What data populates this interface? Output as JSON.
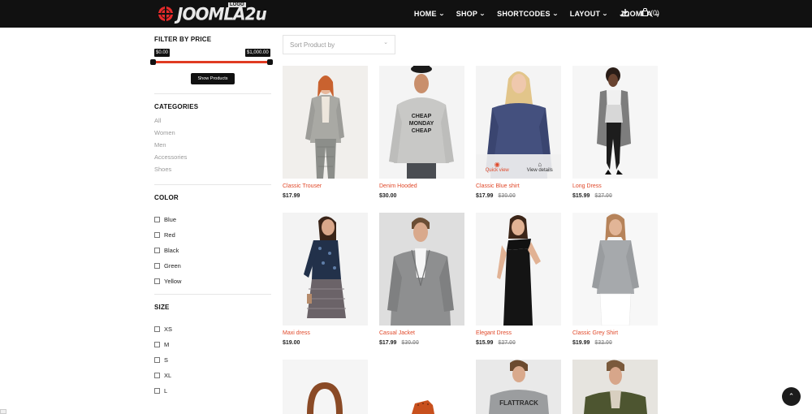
{
  "header": {
    "logo_text": "JOOMLA2u",
    "logo_badge": "LOGO",
    "nav": [
      {
        "label": "HOME"
      },
      {
        "label": "SHOP"
      },
      {
        "label": "SHORTCODES"
      },
      {
        "label": "LAYOUT"
      },
      {
        "label": "JOOMLA"
      }
    ],
    "cart_label": "(0)"
  },
  "sidebar": {
    "price": {
      "title": "FILTER BY PRICE",
      "min": "$0.00",
      "max": "$1,000.00",
      "button": "Show Products",
      "slider_color": "#e03b22"
    },
    "categories": {
      "title": "CATEGORIES",
      "items": [
        "All",
        "Women",
        "Men",
        "Accessories",
        "Shoes"
      ]
    },
    "color": {
      "title": "COLOR",
      "options": [
        "Blue",
        "Red",
        "Black",
        "Green",
        "Yellow"
      ]
    },
    "size": {
      "title": "SIZE",
      "options": [
        "XS",
        "M",
        "S",
        "XL",
        "L"
      ]
    }
  },
  "main": {
    "sort_placeholder": "Sort Product by",
    "hover": {
      "quick_view": "Quick view",
      "view_details": "View details"
    },
    "products": [
      {
        "name": "Classic Trouser",
        "price": "$17.99",
        "old_price": ""
      },
      {
        "name": "Denim Hooded",
        "price": "$30.00",
        "old_price": ""
      },
      {
        "name": "Classic Blue shirt",
        "price": "$17.99",
        "old_price": "$30.00"
      },
      {
        "name": "Long Dress",
        "price": "$15.99",
        "old_price": "$27.00"
      },
      {
        "name": "Maxi dress",
        "price": "$19.00",
        "old_price": ""
      },
      {
        "name": "Casual Jacket",
        "price": "$17.99",
        "old_price": "$30.00"
      },
      {
        "name": "Elegant Dress",
        "price": "$15.99",
        "old_price": "$27.00"
      },
      {
        "name": "Classic Grey Shirt",
        "price": "$19.99",
        "old_price": "$32.00"
      },
      {
        "name": "",
        "price": "",
        "old_price": ""
      },
      {
        "name": "",
        "price": "",
        "old_price": ""
      },
      {
        "name": "",
        "price": "",
        "old_price": ""
      },
      {
        "name": "",
        "price": "",
        "old_price": ""
      }
    ],
    "sweatshirt_text": "CHEAP MONDAY CHEAP",
    "tee_text": "FLATTRACK"
  },
  "colors": {
    "accent": "#e0492a",
    "header_bg": "#111111"
  }
}
